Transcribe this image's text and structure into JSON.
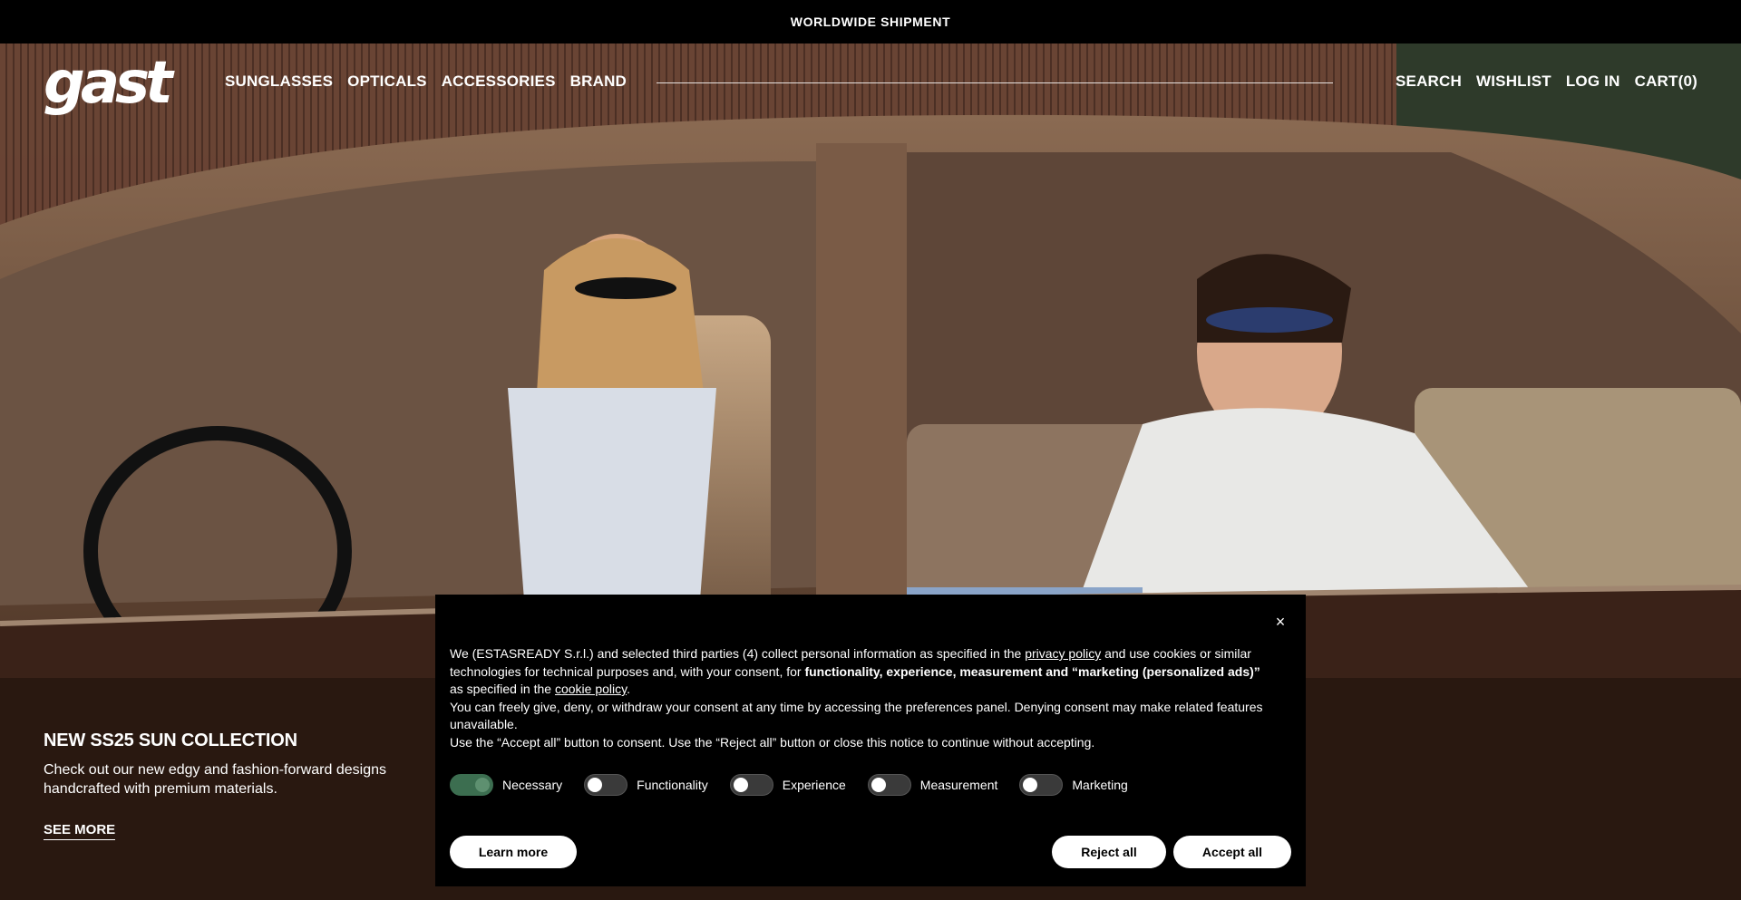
{
  "announcement": {
    "text": "WORLDWIDE SHIPMENT"
  },
  "header": {
    "logo_text": "gast",
    "nav_left": [
      "SUNGLASSES",
      "OPTICALS",
      "ACCESSORIES",
      "BRAND"
    ],
    "nav_right": {
      "search": "SEARCH",
      "wishlist": "WISHLIST",
      "login": "LOG IN",
      "cart": "CART(0)"
    }
  },
  "hero": {
    "title": "NEW SS25 SUN COLLECTION",
    "description": "Check out our new edgy and fashion-forward designs handcrafted with premium materials.",
    "cta": "SEE MORE"
  },
  "cookie_banner": {
    "close_icon": "×",
    "p1_a": "We (ESTASREADY S.r.l.) and selected third parties (4) collect personal information as specified in the ",
    "p1_link1": "privacy policy",
    "p1_b": " and use cookies or similar technologies for technical purposes and, with your consent, for ",
    "p1_bold": "functionality, experience, measurement and “marketing (personalized ads)”",
    "p1_c": " as specified in the ",
    "p1_link2": "cookie policy",
    "p1_d": ".",
    "p2": "You can freely give, deny, or withdraw your consent at any time by accessing the preferences panel. Denying consent may make related features unavailable.",
    "p3": "Use the “Accept all” button to consent. Use the “Reject all” button or close this notice to continue without accepting.",
    "toggles": [
      {
        "label": "Necessary",
        "on": true
      },
      {
        "label": "Functionality",
        "on": false
      },
      {
        "label": "Experience",
        "on": false
      },
      {
        "label": "Measurement",
        "on": false
      },
      {
        "label": "Marketing",
        "on": false
      }
    ],
    "buttons": {
      "learn": "Learn more",
      "reject": "Reject all",
      "accept": "Accept all"
    }
  }
}
